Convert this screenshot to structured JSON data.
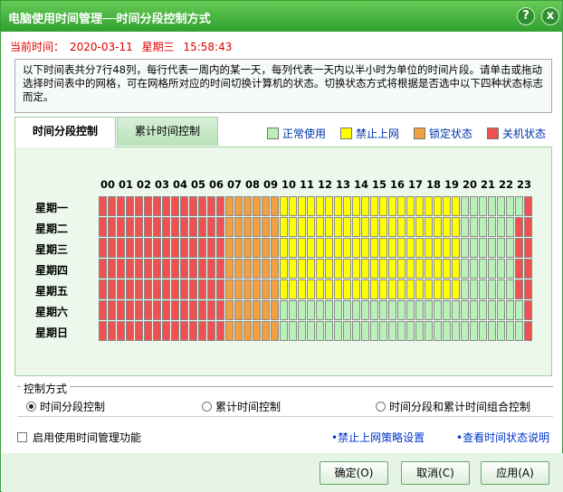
{
  "window": {
    "title": "电脑使用时间管理──时间分段控制方式",
    "help_icon": "?",
    "close_icon": "x"
  },
  "current_time": {
    "label": "当前时间：",
    "date": "2020-03-11",
    "weekday": "星期三",
    "time": "15:58:43"
  },
  "description": "以下时间表共分7行48列，每行代表一周内的某一天，每列代表一天内以半小时为单位的时间片段。请单击或拖动选择时间表中的网格，可在网格所对应的时间切换计算机的状态。切换状态方式将根据是否选中以下四种状态标志而定。",
  "tabs": [
    {
      "label": "时间分段控制",
      "active": true
    },
    {
      "label": "累计时间控制",
      "active": false
    }
  ],
  "legend": [
    {
      "label": "正常使用",
      "color": "#b8f0b8"
    },
    {
      "label": "禁止上网",
      "color": "#ffff00"
    },
    {
      "label": "锁定状态",
      "color": "#f5a040"
    },
    {
      "label": "关机状态",
      "color": "#f05050"
    }
  ],
  "hours": [
    "00",
    "01",
    "02",
    "03",
    "04",
    "05",
    "06",
    "07",
    "08",
    "09",
    "10",
    "11",
    "12",
    "13",
    "14",
    "15",
    "16",
    "17",
    "18",
    "19",
    "20",
    "21",
    "22",
    "23"
  ],
  "days": [
    "星期一",
    "星期二",
    "星期三",
    "星期四",
    "星期五",
    "星期六",
    "星期日"
  ],
  "schedule_encoding": "r=关机状态, o=锁定状态, y=禁止上网, g=正常使用; 48 half-hour slots per day",
  "schedule": [
    "rrrrrrrrrrrrrrooooooyyyyyyyyyyyyyyyyyyyygggggggrrrrrr",
    "rrrrrrrrrrrrrrooooooyyyyyyyyyyyyyyyyyyyyggggggrrrrrr",
    "rrrrrrrrrrrrrrooooooyyyyyyyyyyyyyyyyyyyyggggggrrrrrr",
    "rrrrrrrrrrrrrrooooooyyyyyyyyyyyyyyyyyyyyggggggrrrrrr",
    "rrrrrrrrrrrrrrooooooyyyyyyyyyyyyyyyyyyyyggggggrrrrrr",
    "rrrrrrrrrrrrrroooooogggggggggggggggggggggggggggrrrrrr",
    "rrrrrrrrrrrrrroooooogggggggggggggggggggggggggggrrrrrr"
  ],
  "control": {
    "legend": "控制方式",
    "options": [
      {
        "label": "时间分段控制",
        "selected": true
      },
      {
        "label": "累计时间控制",
        "selected": false
      },
      {
        "label": "时间分段和累计时间组合控制",
        "selected": false
      }
    ]
  },
  "enable_checkbox": {
    "label": "启用使用时间管理功能",
    "checked": false
  },
  "links": {
    "policy": "•禁止上网策略设置",
    "status_help": "•查看时间状态说明"
  },
  "buttons": {
    "ok": "确定(O)",
    "cancel": "取消(C)",
    "apply": "应用(A)"
  }
}
